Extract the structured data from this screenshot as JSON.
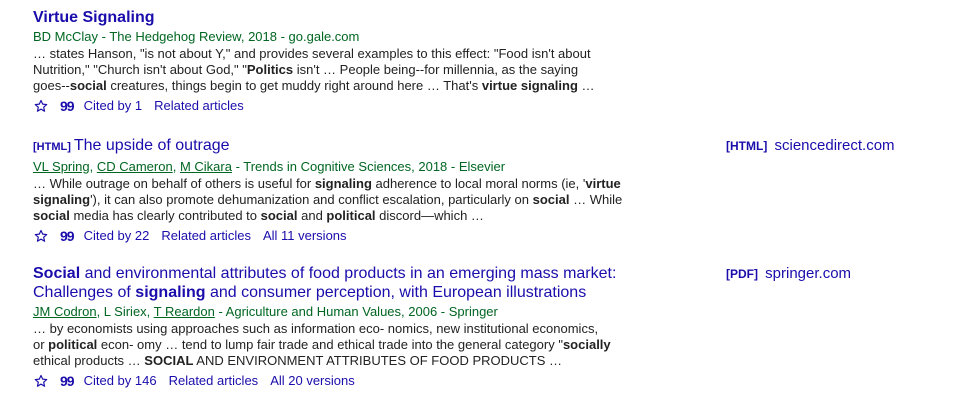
{
  "results": [
    {
      "title": "Virtue Signaling",
      "meta": "BD McClay - The Hedgehog Review, 2018 - go.gale.com",
      "snippet": [
        "… states Hanson, \"is not about Y,\" and provides several examples to this effect: \"Food isn't about",
        "Nutrition,\" \"Church isn't about God,\" \"",
        "Politics",
        " isn't … People being--for millennia, as the saying",
        "goes--",
        "social",
        " creatures, things begin to get muddy right around here … That's ",
        "virtue signaling",
        " …"
      ],
      "cited": "Cited by 1",
      "related": "Related articles"
    },
    {
      "tag": "[HTML]",
      "title": "The upside of outrage",
      "authors": [
        "VL Spring",
        "CD Cameron",
        "M Cikara"
      ],
      "meta_rest": " - Trends in Cognitive Sciences, 2018 - Elsevier",
      "snippet": [
        "… While outrage on behalf of others is useful for ",
        "signaling",
        " adherence to local moral norms (ie, '",
        "virtue signaling",
        "'), it can also promote dehumanization and conflict escalation, particularly on ",
        "social",
        " … While ",
        "social",
        " media has clearly contributed to ",
        "social",
        " and ",
        "political",
        " discord—which …"
      ],
      "cited": "Cited by 22",
      "related": "Related articles",
      "versions": "All 11 versions",
      "side_tag": "[HTML]",
      "side_source": "sciencedirect.com"
    },
    {
      "title_parts": [
        "Social",
        " and environmental attributes of food products in an emerging mass market: Challenges of ",
        "signaling",
        " and consumer perception, with European illustrations"
      ],
      "authors_a": [
        "JM Codron"
      ],
      "authors_mid": ", L Siriex, ",
      "authors_b": [
        "T Reardon"
      ],
      "meta_rest": " - Agriculture and Human Values, 2006 - Springer",
      "snippet": [
        "… by economists using approaches such as information eco- nomics, new institutional economics,",
        "or ",
        "political",
        " econ- omy … tend to lump fair trade and ethical trade into the general category \"",
        "socially",
        "ethical products … ",
        "SOCIAL",
        " AND ENVIRONMENT ATTRIBUTES OF FOOD PRODUCTS …"
      ],
      "cited": "Cited by 146",
      "related": "Related articles",
      "versions": "All 20 versions",
      "side_tag": "[PDF]",
      "side_source": "springer.com"
    }
  ],
  "quote_glyph": "99",
  "icons": {
    "save": "star-icon",
    "cite": "quote-icon"
  },
  "colors": {
    "link": "#1a0dab",
    "meta": "#006621",
    "text": "#222222"
  }
}
